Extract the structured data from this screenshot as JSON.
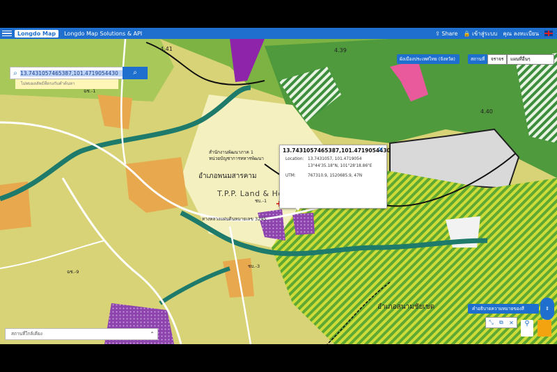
{
  "header": {
    "logo": "Longdo Map",
    "brand": "Longdo Map Solutions & API",
    "share": "Share",
    "login": "เข้าสู่ระบบ",
    "user": "คุณ ลงทะเบียน"
  },
  "search": {
    "value": "13.7431057465387,101.4719054430",
    "hint": "ไม่พบผลลัพธ์ที่ตรงกับคำค้นหา"
  },
  "controls": {
    "layer_button": "ผังเมืองประเทศไทย (จังหวัด)",
    "area_button": "สถานที่",
    "traffic_select": "จราจร",
    "map_select": "แผนที่อื่นๆ"
  },
  "popup": {
    "title": "13.7431057465387,101.4719054430",
    "location_label": "Location:",
    "location_dec": "13.7431057, 101.4719054",
    "location_dms": "13°44'35.18\"N, 101°28'18.86\"E",
    "utm_label": "UTM:",
    "utm": "767310.9, 1520685.9, 47N"
  },
  "watermark": "T.P.P. Land & House Co.,Ltd.",
  "bottom": {
    "search_placeholder": "สถานที่ใกล้เคียง",
    "legend_button": "คำอธิบายความหมายของสี"
  },
  "map_labels": [
    "อำเภอพนมสารคาม",
    "อำเภอสนามชัยเขต",
    "สำนักงานพัฒนาภาค 1",
    "หน่วยบัญชาการทหารพัฒนา",
    "ทางหลวงแผ่นดินหมายเลข 3245",
    "ชบ.-1",
    "ชบ.-3",
    "ฉช.-1",
    "ฉช.-9",
    "4.39",
    "4.40",
    "4.41"
  ]
}
